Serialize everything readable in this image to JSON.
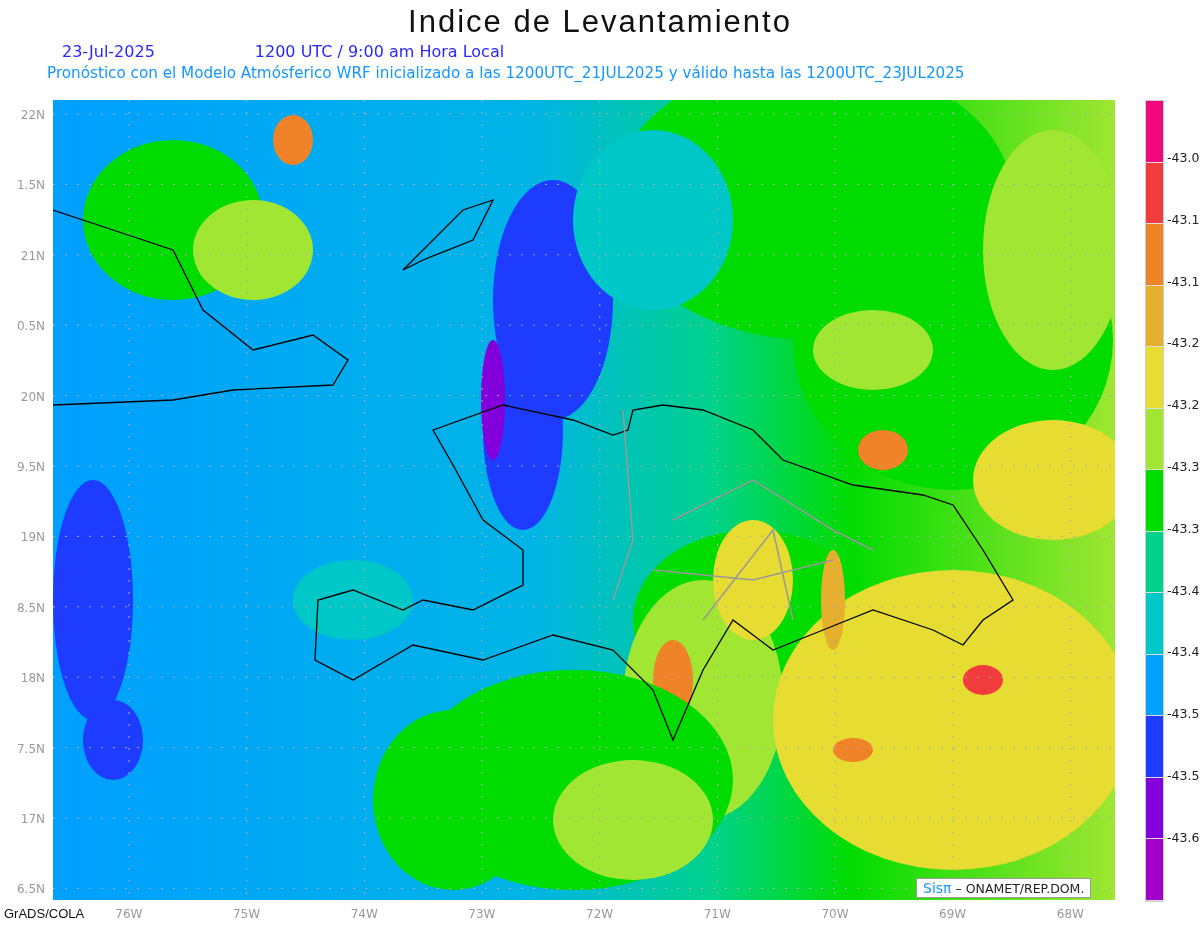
{
  "title": "Indice de Levantamiento",
  "date": "23-Jul-2025",
  "time": "1200 UTC / 9:00 am Hora Local",
  "subtitle": "Pronóstico con el Modelo Atmósferico WRF inicializado a las 1200UTC_21JUL2025 y válido hasta las  1200UTC_23JUL2025",
  "lat_labels": [
    "22N",
    "1.5N",
    "21N",
    "0.5N",
    "20N",
    "9.5N",
    "19N",
    "8.5N",
    "18N",
    "7.5N",
    "17N",
    "6.5N"
  ],
  "lon_labels": [
    "76W",
    "75W",
    "74W",
    "73W",
    "72W",
    "71W",
    "70W",
    "69W",
    "68W"
  ],
  "colorbar": {
    "segments": [
      {
        "color": "#f0087f"
      },
      {
        "color": "#f03c3c"
      },
      {
        "color": "#f08228"
      },
      {
        "color": "#e6af2d"
      },
      {
        "color": "#e6dc32"
      },
      {
        "color": "#a0e632"
      },
      {
        "color": "#00dc00"
      },
      {
        "color": "#00d28c"
      },
      {
        "color": "#00c8c8"
      },
      {
        "color": "#00a0ff"
      },
      {
        "color": "#1e3cff"
      },
      {
        "color": "#8200dc"
      },
      {
        "color": "#a000c8"
      }
    ],
    "labels": [
      "-43.0",
      "-43.1",
      "-43.1",
      "-43.2",
      "-43.2",
      "-43.3",
      "-43.3",
      "-43.4",
      "-43.4",
      "-43.5",
      "-43.5",
      "-43.6"
    ]
  },
  "credit": {
    "brand": "Sisπ",
    "text": "– ONAMET/REP.DOM."
  },
  "footer": "GrADS/COLA"
}
